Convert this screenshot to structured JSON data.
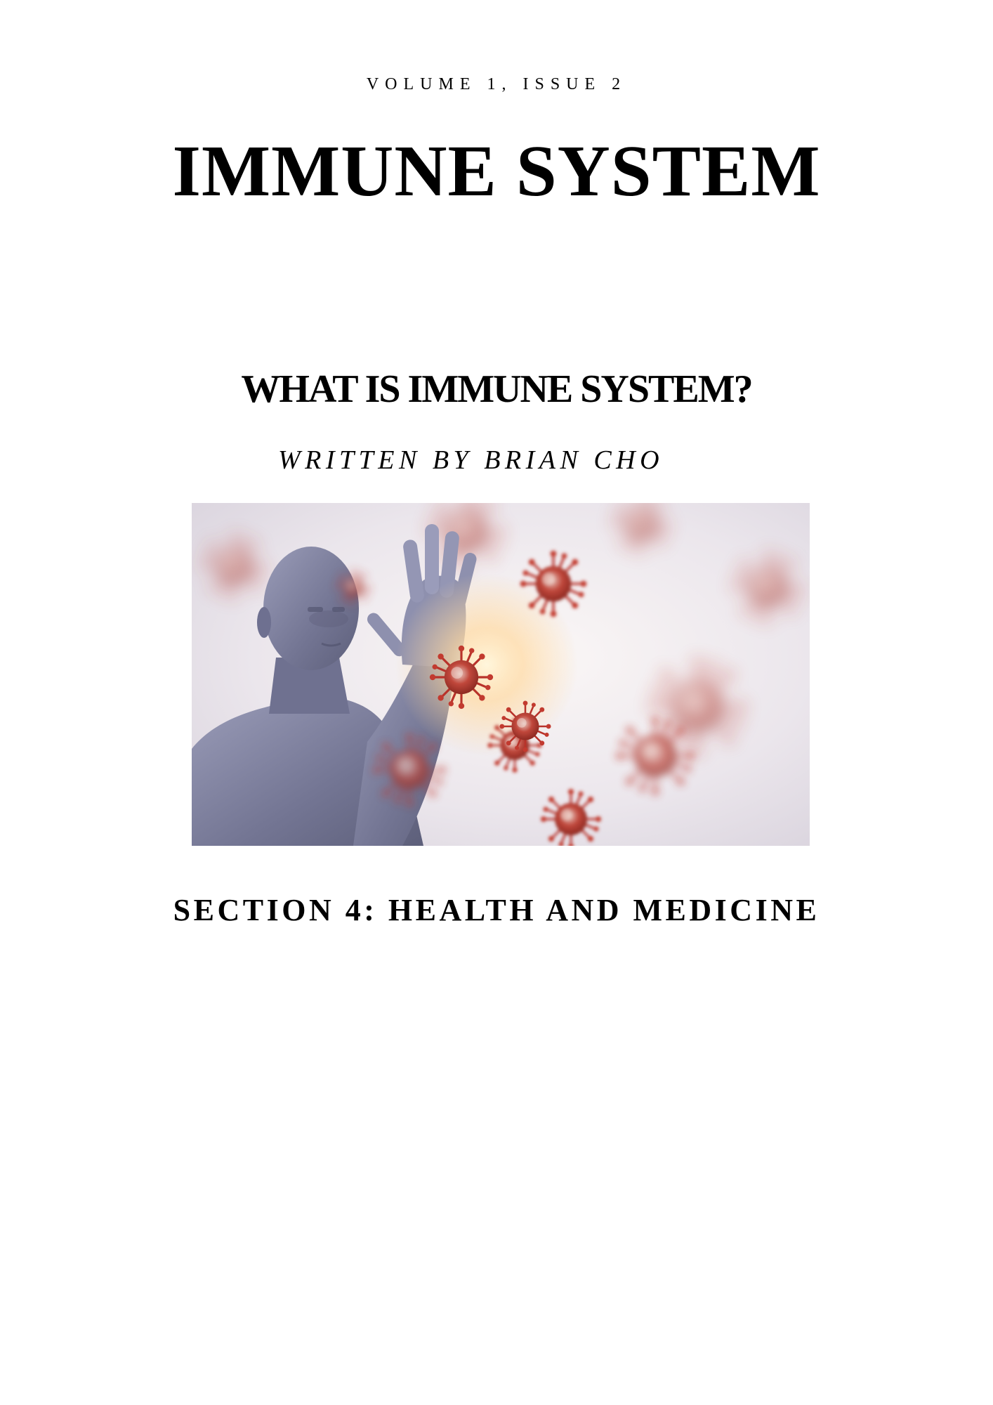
{
  "header": {
    "volume": "VOLUME 1, ISSUE 2",
    "title": "IMMUNE SYSTEM"
  },
  "article": {
    "headline": "WHAT IS IMMUNE SYSTEM?",
    "byline": "WRITTEN BY BRIAN CHO",
    "image": {
      "subject": "human figure holding up a hand against floating virus particles",
      "icon": "virus-illustration"
    },
    "section": "SECTION 4: HEALTH AND MEDICINE"
  },
  "colors": {
    "text": "#000000",
    "background": "#ffffff",
    "virus": "#b8322a",
    "figure": "#7c7f9e"
  }
}
